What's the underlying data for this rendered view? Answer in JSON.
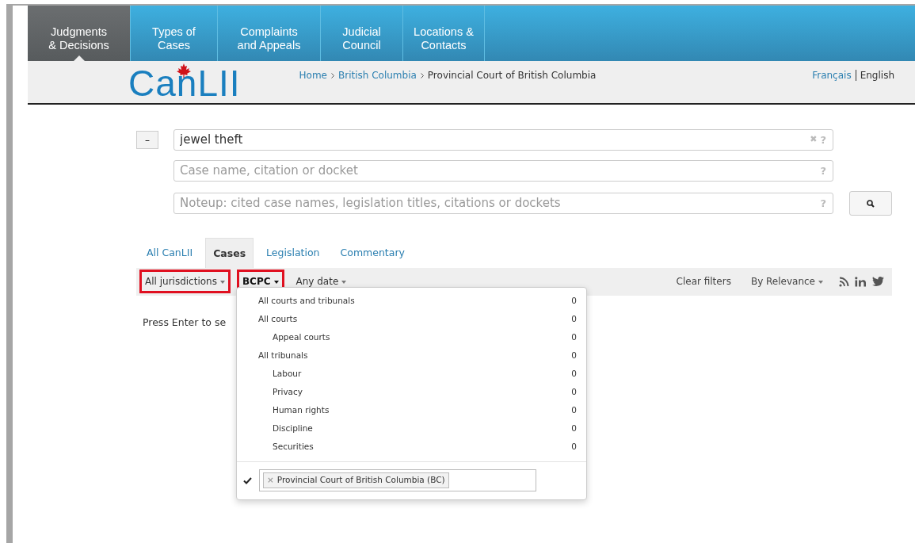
{
  "nav": [
    {
      "label": "Judgments\n& Decisions",
      "selected": true
    },
    {
      "label": "Types of\nCases",
      "selected": false
    },
    {
      "label": "Complaints\nand Appeals",
      "selected": false
    },
    {
      "label": "Judicial\nCouncil",
      "selected": false
    },
    {
      "label": "Locations &\nContacts",
      "selected": false
    }
  ],
  "logo": {
    "text": "CanLII"
  },
  "breadcrumb": [
    {
      "label": "Home",
      "kind": "link"
    },
    {
      "label": "British Columbia",
      "kind": "link"
    },
    {
      "label": "Provincial Court of British Columbia",
      "kind": "current"
    }
  ],
  "languages": [
    {
      "label": "Français",
      "selected": false
    },
    {
      "label": "English",
      "selected": true
    }
  ],
  "search": {
    "toggle": "–",
    "fields": [
      {
        "value": "jewel theft",
        "clear": "✖",
        "help": "?"
      },
      {
        "placeholder": "Case name, citation or docket",
        "help": "?"
      },
      {
        "placeholder": "Noteup: cited case names, legislation titles, citations or dockets",
        "help": "?"
      }
    ]
  },
  "tabs": [
    {
      "label": "All CanLII",
      "selected": false
    },
    {
      "label": "Cases",
      "selected": true
    },
    {
      "label": "Legislation",
      "selected": false
    },
    {
      "label": "Commentary",
      "selected": false
    }
  ],
  "filters": [
    {
      "label": "All jurisdictions",
      "highlighted": true,
      "bold": false
    },
    {
      "label": "BCPC",
      "highlighted": true,
      "bold": true
    },
    {
      "label": "Any date",
      "highlighted": false,
      "bold": false
    }
  ],
  "toolbar": {
    "clear": "Clear filters",
    "sort": "By Relevance"
  },
  "message": "Press Enter to se",
  "court_menu": {
    "items": [
      {
        "label": "All courts and tribunals",
        "count": "0"
      },
      {
        "label": "All courts",
        "count": "0",
        "children": [
          {
            "label": "Appeal courts",
            "count": "0"
          }
        ]
      },
      {
        "label": "All tribunals",
        "count": "0",
        "children": [
          {
            "label": "Labour",
            "count": "0"
          },
          {
            "label": "Privacy",
            "count": "0"
          },
          {
            "label": "Human rights",
            "count": "0"
          },
          {
            "label": "Discipline",
            "count": "0"
          },
          {
            "label": "Securities",
            "count": "0"
          }
        ]
      }
    ],
    "selected_tags": [
      {
        "remove": "×",
        "label": "Provincial Court of British Columbia (BC)"
      }
    ]
  }
}
